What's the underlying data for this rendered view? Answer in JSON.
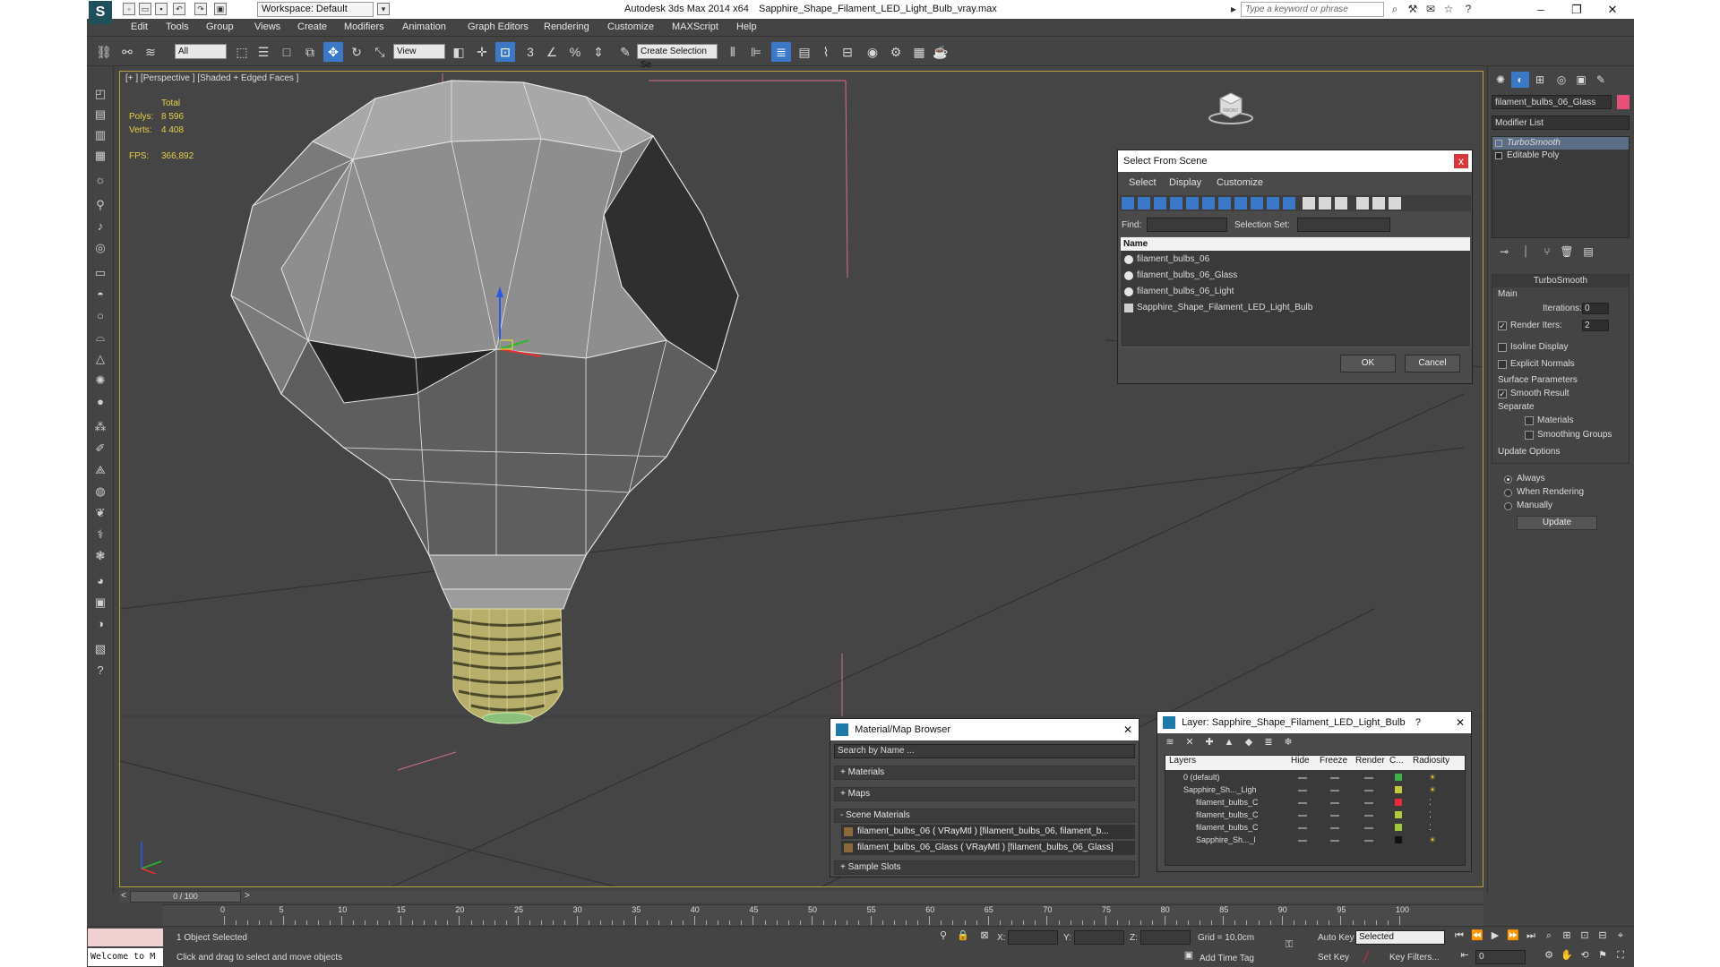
{
  "titlebar": {
    "logo": "S",
    "workspace": "Workspace: Default",
    "app_title": "Autodesk 3ds Max  2014 x64",
    "file_title": "Sapphire_Shape_Filament_LED_Light_Bulb_vray.max",
    "search_placeholder": "Type a keyword or phrase"
  },
  "menu": [
    "Edit",
    "Tools",
    "Group",
    "Views",
    "Create",
    "Modifiers",
    "Animation",
    "Graph Editors",
    "Rendering",
    "Customize",
    "MAXScript",
    "Help"
  ],
  "toolbar": {
    "filter_select": "All",
    "coord_select": "View",
    "selection_set": "Create Selection Se",
    "snap_label": "3"
  },
  "viewport": {
    "label": "[+ ] [Perspective ] [Shaded + Edged Faces ]",
    "stats_header": "Total",
    "polys_label": "Polys:",
    "polys": "8 596",
    "verts_label": "Verts:",
    "verts": "4 408",
    "fps_label": "FPS:",
    "fps": "366,892",
    "viewcube_label": "FRONT"
  },
  "command_panel": {
    "object_name": "filament_bulbs_06_Glass",
    "object_color": "#e8507a",
    "modifier_list": "Modifier List",
    "stack": [
      "TurboSmooth",
      "Editable Poly"
    ],
    "rollout_title": "TurboSmooth",
    "main_label": "Main",
    "iterations_label": "Iterations:",
    "iterations": "0",
    "render_iters_label": "Render Iters:",
    "render_iters": "2",
    "isoline": "Isoline Display",
    "explicit_normals": "Explicit Normals",
    "surface_params": "Surface Parameters",
    "smooth_result": "Smooth Result",
    "separate": "Separate",
    "materials": "Materials",
    "smoothing_groups": "Smoothing Groups",
    "update_options": "Update Options",
    "always": "Always",
    "when_rendering": "When Rendering",
    "manually": "Manually",
    "update_btn": "Update"
  },
  "select_from_scene": {
    "title": "Select From Scene",
    "close": "x",
    "menus": [
      "Select",
      "Display",
      "Customize"
    ],
    "find_label": "Find:",
    "selection_set_label": "Selection Set:",
    "name_header": "Name",
    "items": [
      "filament_bulbs_06",
      "filament_bulbs_06_Glass",
      "filament_bulbs_06_Light",
      "Sapphire_Shape_Filament_LED_Light_Bulb"
    ],
    "ok": "OK",
    "cancel": "Cancel"
  },
  "material_browser": {
    "title": "Material/Map Browser",
    "close": "✕",
    "search": "Search by Name ...",
    "materials": "+ Materials",
    "maps": "+ Maps",
    "scene_materials": "- Scene Materials",
    "mat1": "filament_bulbs_06 ( VRayMtl ) [filament_bulbs_06, filament_b...",
    "mat2": "filament_bulbs_06_Glass ( VRayMtl ) [filament_bulbs_06_Glass]",
    "sample_slots": "+ Sample Slots"
  },
  "layer_manager": {
    "title": "Layer: Sapphire_Shape_Filament_LED_Light_Bulb",
    "help": "?",
    "close": "✕",
    "col_layers": "Layers",
    "col_hide": "Hide",
    "col_freeze": "Freeze",
    "col_render": "Render",
    "col_color": "C...",
    "col_radiosity": "Radiosity",
    "rows": [
      {
        "name": "0 (default)",
        "color": "#3cb44b"
      },
      {
        "name": "Sapphire_Sh..._Ligh",
        "color": "#c8c83c"
      },
      {
        "name": "filament_bulbs_C",
        "color": "#e8283c"
      },
      {
        "name": "filament_bulbs_C",
        "color": "#b4c83c"
      },
      {
        "name": "filament_bulbs_C",
        "color": "#a0c83c"
      },
      {
        "name": "Sapphire_Sh..._l",
        "color": "#111111"
      }
    ]
  },
  "timeline": {
    "slider": "0 / 100",
    "prev": "<",
    "next": ">",
    "ticks": [
      "0",
      "5",
      "10",
      "15",
      "20",
      "25",
      "30",
      "35",
      "40",
      "45",
      "50",
      "55",
      "60",
      "65",
      "70",
      "75",
      "80",
      "85",
      "90",
      "95",
      "100"
    ]
  },
  "status": {
    "maxscript": "Welcome to M",
    "selected": "1 Object Selected",
    "prompt": "Click and drag to select and move objects",
    "x_label": "X:",
    "y_label": "Y:",
    "z_label": "Z:",
    "grid": "Grid = 10,0cm",
    "add_time_tag": "Add Time Tag",
    "auto_key": "Auto Key",
    "set_key": "Set Key",
    "selected_dropdown": "Selected",
    "key_filters": "Key Filters...",
    "frame": "0"
  }
}
